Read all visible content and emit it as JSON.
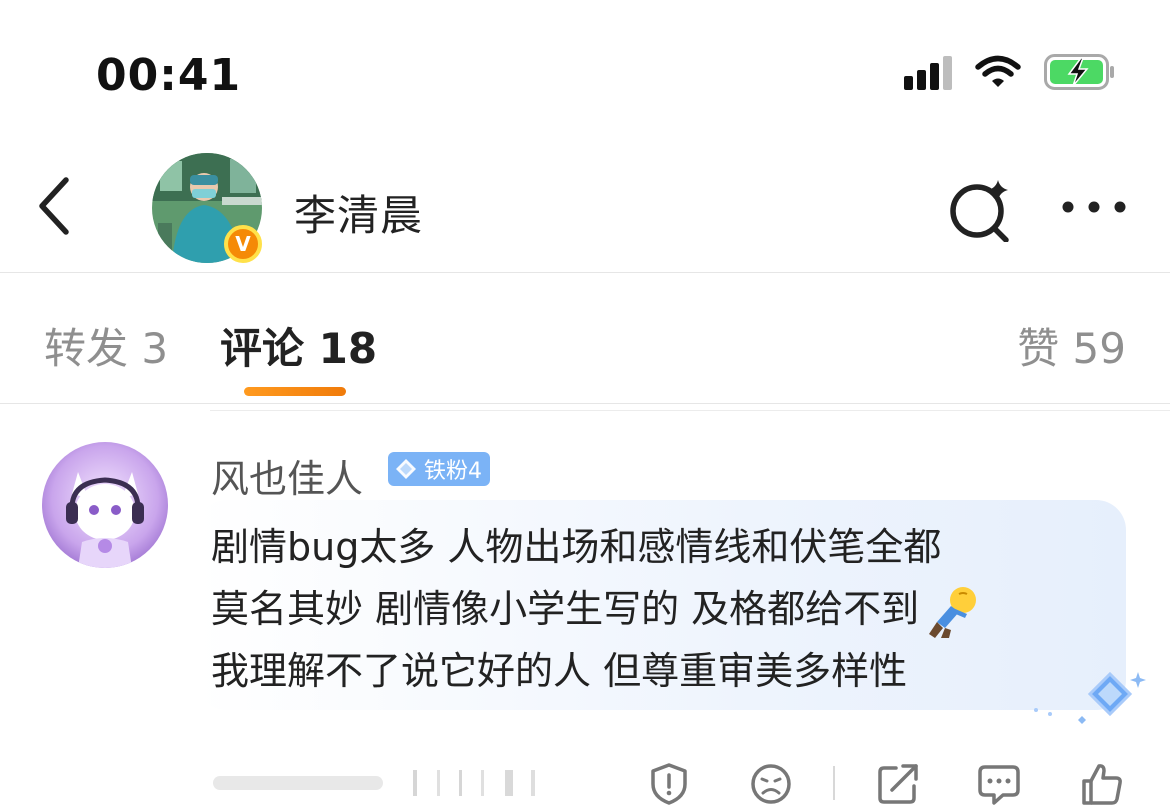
{
  "status_bar": {
    "time": "00:41"
  },
  "header": {
    "user_name": "李清晨",
    "verified_badge": "V"
  },
  "tabs": {
    "repost": "转发 3",
    "comments": "评论 18",
    "likes": "赞 59"
  },
  "comment": {
    "author": "风也佳人",
    "fan_badge": "铁粉4",
    "lines": [
      "剧情bug太多 人物出场和感情线和伏笔全都",
      "莫名其妙 剧情像小学生写的 及格都给不到",
      "我理解不了说它好的人 但尊重审美多样性"
    ]
  },
  "icons": {
    "back": "chevron-left-icon",
    "search": "ai-search-icon",
    "more": "more-dots-icon",
    "report": "report-icon",
    "dislike": "sad-face-icon",
    "share": "share-icon",
    "reply": "comment-icon",
    "like": "thumbs-up-icon"
  },
  "colors": {
    "accent": "#f58a07",
    "fan_badge": "#7bb3f6",
    "text_primary": "#222222",
    "text_secondary": "#8f8f8f"
  }
}
